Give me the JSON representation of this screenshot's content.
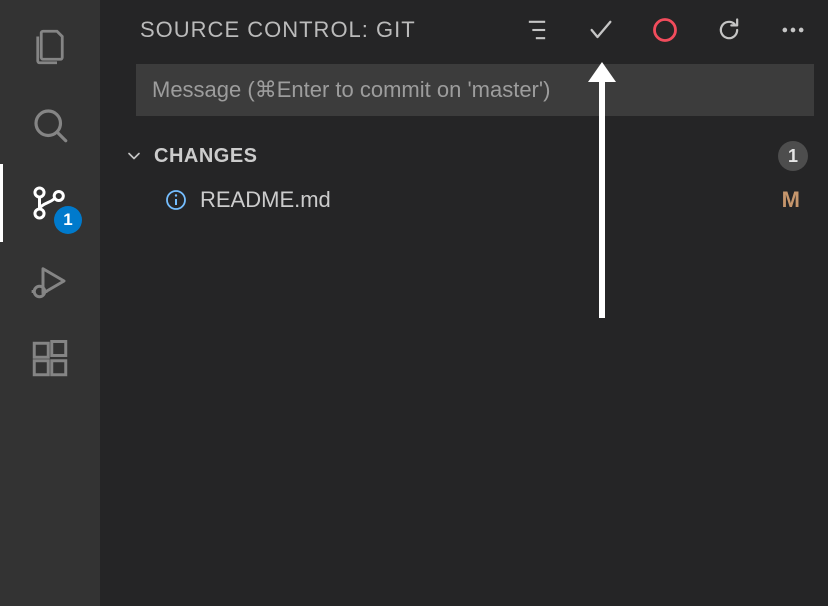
{
  "activityBar": {
    "sourceControlBadge": "1"
  },
  "panel": {
    "title": "SOURCE CONTROL: GIT"
  },
  "commit": {
    "placeholder": "Message (⌘Enter to commit on 'master')"
  },
  "changes": {
    "label": "CHANGES",
    "count": "1",
    "files": [
      {
        "name": "README.md",
        "status": "M"
      }
    ]
  },
  "colors": {
    "circleAction": "#f14c5c",
    "modified": "#c6966c",
    "badge": "#007acc"
  }
}
